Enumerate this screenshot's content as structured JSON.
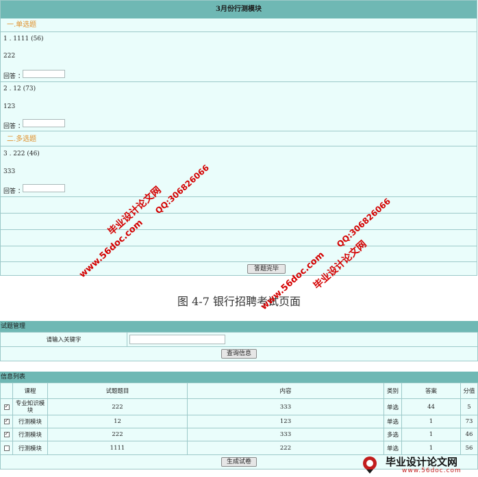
{
  "exam": {
    "title": "3月份行测模块",
    "sections": [
      {
        "title": "一.单选题"
      },
      {
        "title": "二.多选题"
      }
    ],
    "questions": [
      {
        "header": "1 . 1111 (56)",
        "content": "222",
        "answer_label": "回答 ：",
        "answer_value": ""
      },
      {
        "header": "2 . 12 (73)",
        "content": "123",
        "answer_label": "回答 ：",
        "answer_value": ""
      },
      {
        "header": "3 . 222 (46)",
        "content": "333",
        "answer_label": "回答 ：",
        "answer_value": ""
      }
    ],
    "submit_label": "答题完毕"
  },
  "caption": "图 4-7  银行招聘考试页面",
  "question_mgmt": {
    "header": "试题管理",
    "keyword_label": "请输入关键字",
    "keyword_value": "",
    "search_label": "查询信息"
  },
  "info_list": {
    "header": "信息列表",
    "columns": [
      "",
      "课程",
      "试题题目",
      "内容",
      "类别",
      "答案",
      "分值"
    ],
    "rows": [
      {
        "checked": true,
        "course": "专业知识模块",
        "title": "222",
        "content": "333",
        "category": "单选",
        "answer": "44",
        "score": "5"
      },
      {
        "checked": true,
        "course": "行测模块",
        "title": "12",
        "content": "123",
        "category": "单选",
        "answer": "1",
        "score": "73"
      },
      {
        "checked": true,
        "course": "行测模块",
        "title": "222",
        "content": "333",
        "category": "多选",
        "answer": "1",
        "score": "46"
      },
      {
        "checked": false,
        "course": "行测模块",
        "title": "1111",
        "content": "222",
        "category": "单选",
        "answer": "1",
        "score": "56"
      }
    ],
    "generate_label": "生成试卷"
  },
  "watermarks": {
    "site_cn": "毕业设计论文网",
    "site_url": "www.56doc.com",
    "qq": "QQ:306826066",
    "colors": {
      "watermark": "#d40000",
      "header": "#6fb8b4",
      "panel_bg": "#eafdfb",
      "section_title": "#e0902a"
    }
  },
  "footer_logo": {
    "title": "毕业设计论文网",
    "url": "www.56doc.com"
  }
}
